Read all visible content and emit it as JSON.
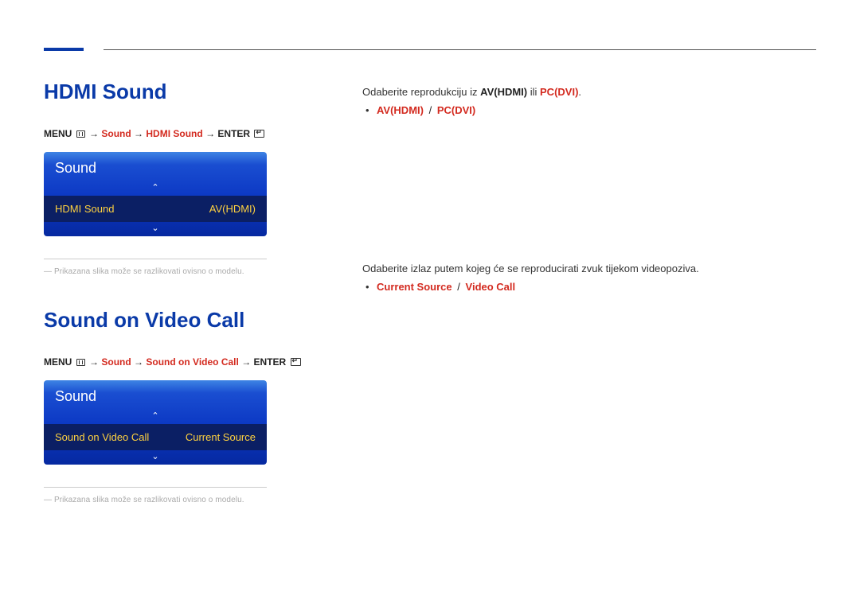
{
  "section1": {
    "heading": "HDMI Sound",
    "menu_path": {
      "menu_label": "MENU",
      "p1": "Sound",
      "p2": "HDMI Sound",
      "enter_label": "ENTER"
    },
    "osd": {
      "title": "Sound",
      "item_label": "HDMI Sound",
      "item_value": "AV(HDMI)",
      "up_glyph": "⌃",
      "down_glyph": "⌄"
    },
    "note": "― Prikazana slika može se razlikovati ovisno o modelu.",
    "desc": {
      "before": "Odaberite reprodukciju iz ",
      "b1": "AV(HDMI)",
      "mid": " ili ",
      "b2": "PC(DVI)",
      "after": "."
    },
    "options": {
      "o1": "AV(HDMI)",
      "sep": "/",
      "o2": "PC(DVI)"
    }
  },
  "section2": {
    "heading": "Sound on Video Call",
    "menu_path": {
      "menu_label": "MENU",
      "p1": "Sound",
      "p2": "Sound on Video Call",
      "enter_label": "ENTER"
    },
    "osd": {
      "title": "Sound",
      "item_label": "Sound on Video Call",
      "item_value": "Current Source",
      "up_glyph": "⌃",
      "down_glyph": "⌄"
    },
    "note": "― Prikazana slika može se razlikovati ovisno o modelu.",
    "desc": {
      "line": "Odaberite izlaz putem kojeg će se reproducirati zvuk tijekom videopoziva."
    },
    "options": {
      "o1": "Current Source",
      "sep": "/",
      "o2": "Video Call"
    }
  }
}
